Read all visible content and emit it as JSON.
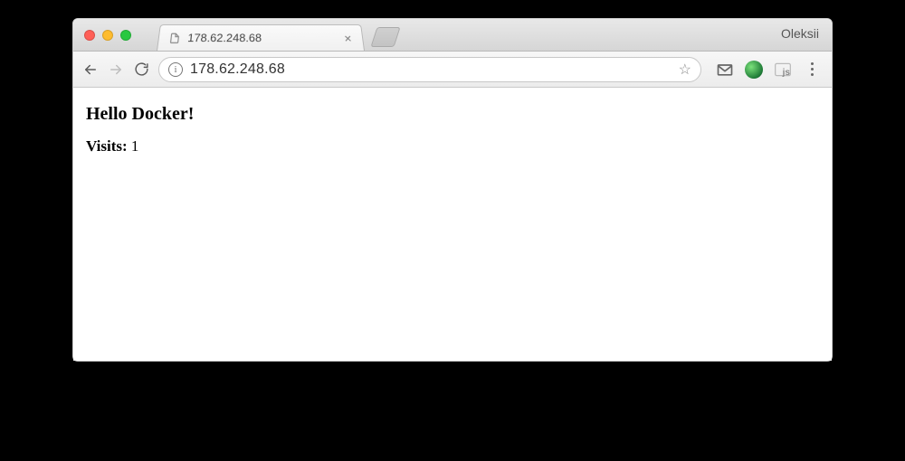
{
  "window": {
    "profile_name": "Oleksii"
  },
  "tab": {
    "title": "178.62.248.68"
  },
  "toolbar": {
    "url": "178.62.248.68",
    "info_glyph": "i",
    "star_glyph": "☆"
  },
  "extensions": {
    "js_label": "js"
  },
  "page": {
    "heading": "Hello Docker!",
    "visits_label": "Visits:",
    "visits_value": "1"
  }
}
